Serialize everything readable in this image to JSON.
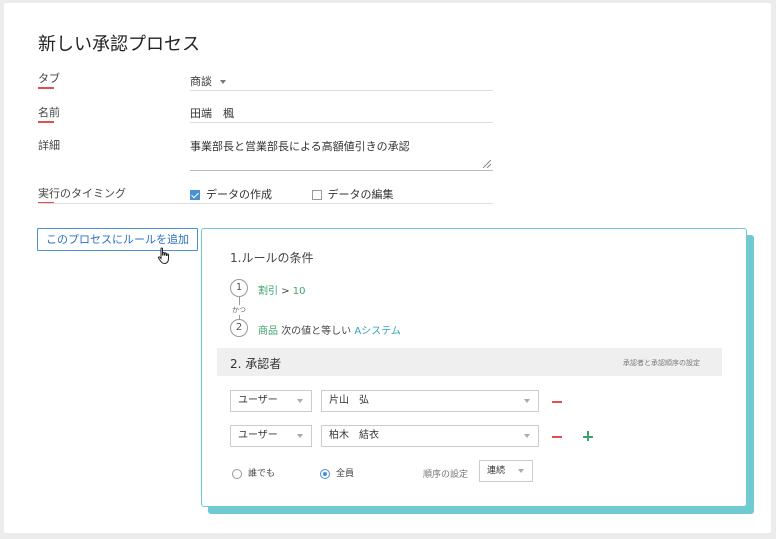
{
  "page": {
    "title": "新しい承認プロセス"
  },
  "form": {
    "tab_label": "タブ",
    "tab_value": "商談",
    "name_label": "名前",
    "name_value": "田端　楓",
    "detail_label": "詳細",
    "detail_value": "事業部長と営業部長による高額値引きの承認",
    "timing_label": "実行のタイミング",
    "timing_options": [
      {
        "label": "データの作成",
        "checked": true
      },
      {
        "label": "データの編集",
        "checked": false
      }
    ]
  },
  "add_rule_button": "このプロセスにルールを追加",
  "rule_panel": {
    "conditions_title": "1.ルールの条件",
    "conditions": [
      {
        "num": "1",
        "field": "割引",
        "op": ">",
        "value": "10"
      },
      {
        "num": "2",
        "field": "商品",
        "op": "次の値と等しい",
        "value": "Aシステム"
      }
    ],
    "join_word": "かつ",
    "approvers_title": "2. 承認者",
    "approvers_link": "承認者と承認順序の設定",
    "approvers": [
      {
        "type": "ユーザー",
        "name": "片山　弘"
      },
      {
        "type": "ユーザー",
        "name": "柏木　結衣"
      }
    ],
    "mode_options": [
      {
        "label": "誰でも",
        "selected": false
      },
      {
        "label": "全員",
        "selected": true
      }
    ],
    "order_label": "順序の設定",
    "order_value": "連続"
  },
  "colors": {
    "accent": "#4a90d9",
    "panel_border": "#6fcad2",
    "green": "#3aa36a",
    "red": "#e05050"
  }
}
